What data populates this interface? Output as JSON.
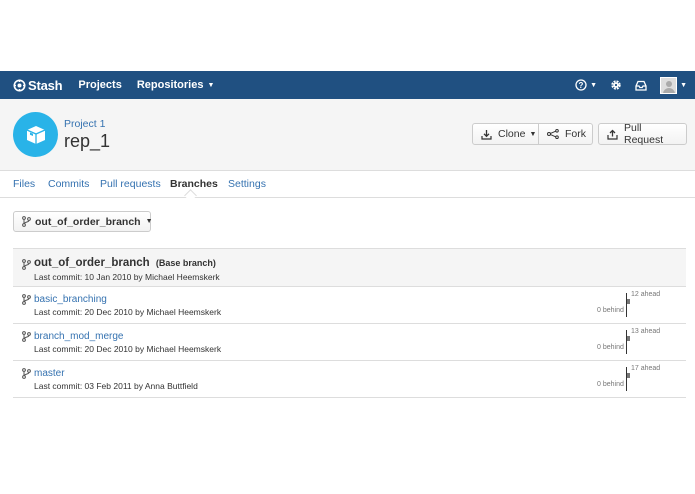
{
  "topbar": {
    "brand": "Stash",
    "nav": [
      {
        "label": "Projects"
      },
      {
        "label": "Repositories"
      }
    ],
    "bg_color": "#205081"
  },
  "header": {
    "project": "Project 1",
    "repo": "rep_1",
    "buttons": {
      "clone": "Clone",
      "fork": "Fork",
      "pull_request": "Pull Request"
    },
    "repo_avatar_color": "#29b3e8"
  },
  "tabs": [
    {
      "label": "Files"
    },
    {
      "label": "Commits"
    },
    {
      "label": "Pull requests"
    },
    {
      "label": "Branches",
      "active": true
    },
    {
      "label": "Settings"
    }
  ],
  "branch_selector": {
    "value": "out_of_order_branch"
  },
  "branches": {
    "base": {
      "name": "out_of_order_branch",
      "tag": "(Base branch)",
      "commit": "Last commit: 10 Jan 2010 by Michael Heemskerk"
    },
    "rows": [
      {
        "name": "basic_branching",
        "commit": "Last commit: 20 Dec 2010 by Michael Heemskerk",
        "ahead": "12 ahead",
        "behind": "0 behind"
      },
      {
        "name": "branch_mod_merge",
        "commit": "Last commit: 20 Dec 2010 by Michael Heemskerk",
        "ahead": "13 ahead",
        "behind": "0 behind"
      },
      {
        "name": "master",
        "commit": "Last commit: 03 Feb 2011 by Anna Buttfield",
        "ahead": "17 ahead",
        "behind": "0 behind"
      }
    ]
  }
}
